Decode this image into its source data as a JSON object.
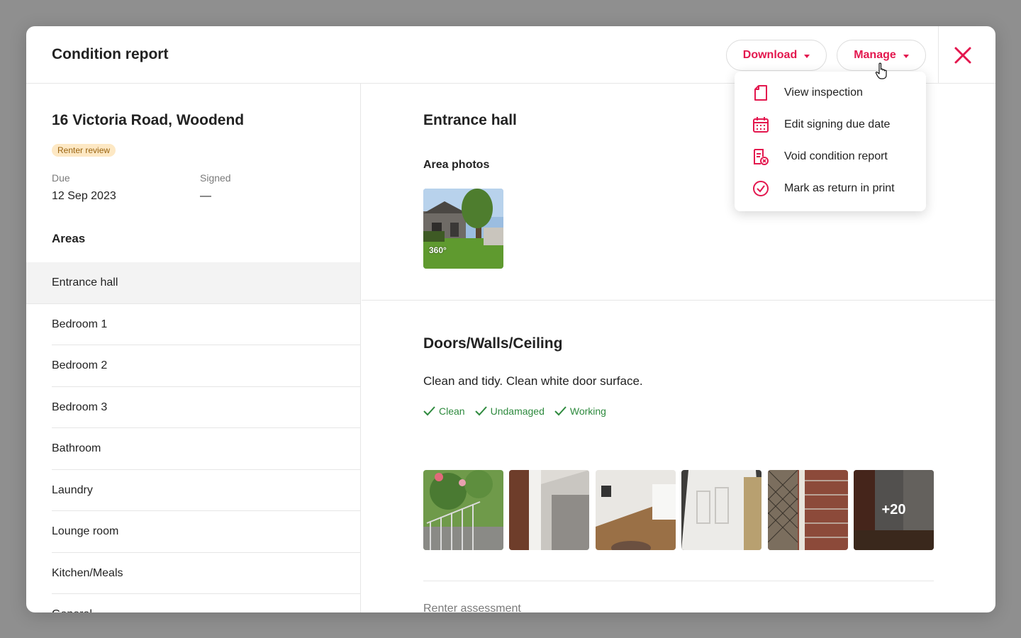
{
  "header": {
    "title": "Condition report",
    "download_label": "Download",
    "manage_label": "Manage"
  },
  "manage_menu": {
    "items": [
      {
        "label": "View inspection",
        "icon": "document-icon"
      },
      {
        "label": "Edit signing due date",
        "icon": "calendar-icon"
      },
      {
        "label": "Void condition report",
        "icon": "void-document-icon"
      },
      {
        "label": "Mark as return in print",
        "icon": "check-circle-icon"
      }
    ]
  },
  "property": {
    "address": "16 Victoria Road, Woodend",
    "status": "Renter review",
    "due_label": "Due",
    "due_value": "12 Sep 2023",
    "signed_label": "Signed",
    "signed_value": "—"
  },
  "areas": {
    "title": "Areas",
    "items": [
      "Entrance hall",
      "Bedroom 1",
      "Bedroom 2",
      "Bedroom 3",
      "Bathroom",
      "Laundry",
      "Lounge room",
      "Kitchen/Meals",
      "General"
    ],
    "active_index": 0
  },
  "main": {
    "area_title": "Entrance hall",
    "area_photos_label": "Area photos",
    "panorama_label": "360°",
    "section_title": "Doors/Walls/Ceiling",
    "description": "Clean and tidy. Clean white door surface.",
    "tags": [
      "Clean",
      "Undamaged",
      "Working"
    ],
    "more_photos": "+20",
    "renter_assessment_label": "Renter assessment"
  },
  "colors": {
    "accent": "#e3174e",
    "success": "#2e8a3e",
    "badge_bg": "#fde8c4",
    "badge_text": "#9a6410"
  }
}
